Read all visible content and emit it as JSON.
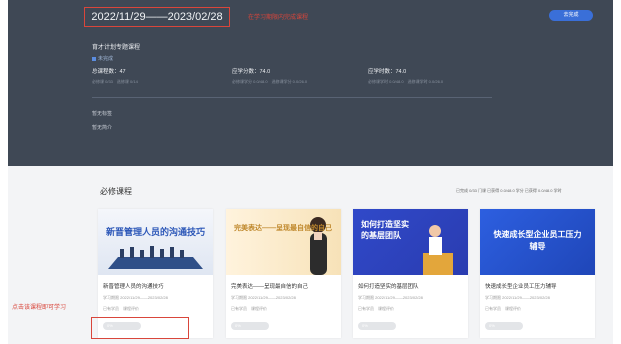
{
  "header": {
    "date_range": "2022/11/29——2023/02/28",
    "annotation": "在学习期限内完成课程",
    "top_button": "去完成"
  },
  "plan": {
    "title": "育才计划专题课程",
    "status": "未完成",
    "stats": [
      {
        "label": "总课程数：47",
        "sub": "必修课 0/33　选修课 0/14"
      },
      {
        "label": "应学分数：74.0",
        "sub": "必修课学分 0.0/48.0　选修课学分 0.0/26.0"
      },
      {
        "label": "应学时数：74.0",
        "sub": "必修课学时 0.0/48.0　选修课学时 0.0/26.0"
      }
    ],
    "links": [
      "暂无标签",
      "暂无简介"
    ]
  },
  "section": {
    "title": "必修课程",
    "stats": "已完成 0/33 门课 已获得 0.0/48.0 学分 已获得 0.0/48.0 学时"
  },
  "annotation_bottom": "点击该课程即可学习",
  "courses": [
    {
      "title": "新晋管理人员的沟通技巧",
      "period": "学习期限 2022/11/29——2023/02/28",
      "meta": "已有学员　课程评价",
      "progress": "0%",
      "thumb_text": "新晋管理人员的沟通技巧"
    },
    {
      "title": "完美表达——呈现最自信的自己",
      "period": "学习期限 2022/11/29——2023/02/28",
      "meta": "已有学员　课程评价",
      "progress": "0%",
      "thumb_text": "完美表达——呈现最自信的自己"
    },
    {
      "title": "如何打造坚实的基层团队",
      "period": "学习期限 2022/11/29——2023/02/28",
      "meta": "已有学员　课程评价",
      "progress": "0%",
      "thumb_text": "如何打造坚实的基层团队"
    },
    {
      "title": "快速成长型企业员工压力辅导",
      "period": "学习期限 2022/11/29——2023/02/28",
      "meta": "已有学员　课程评价",
      "progress": "0%",
      "thumb_text": "快速成长型企业员工压力辅导"
    }
  ],
  "colors": {
    "hero_bg": "#3f4855",
    "accent": "#3a6fd8",
    "annotation_red": "#d9463b"
  }
}
